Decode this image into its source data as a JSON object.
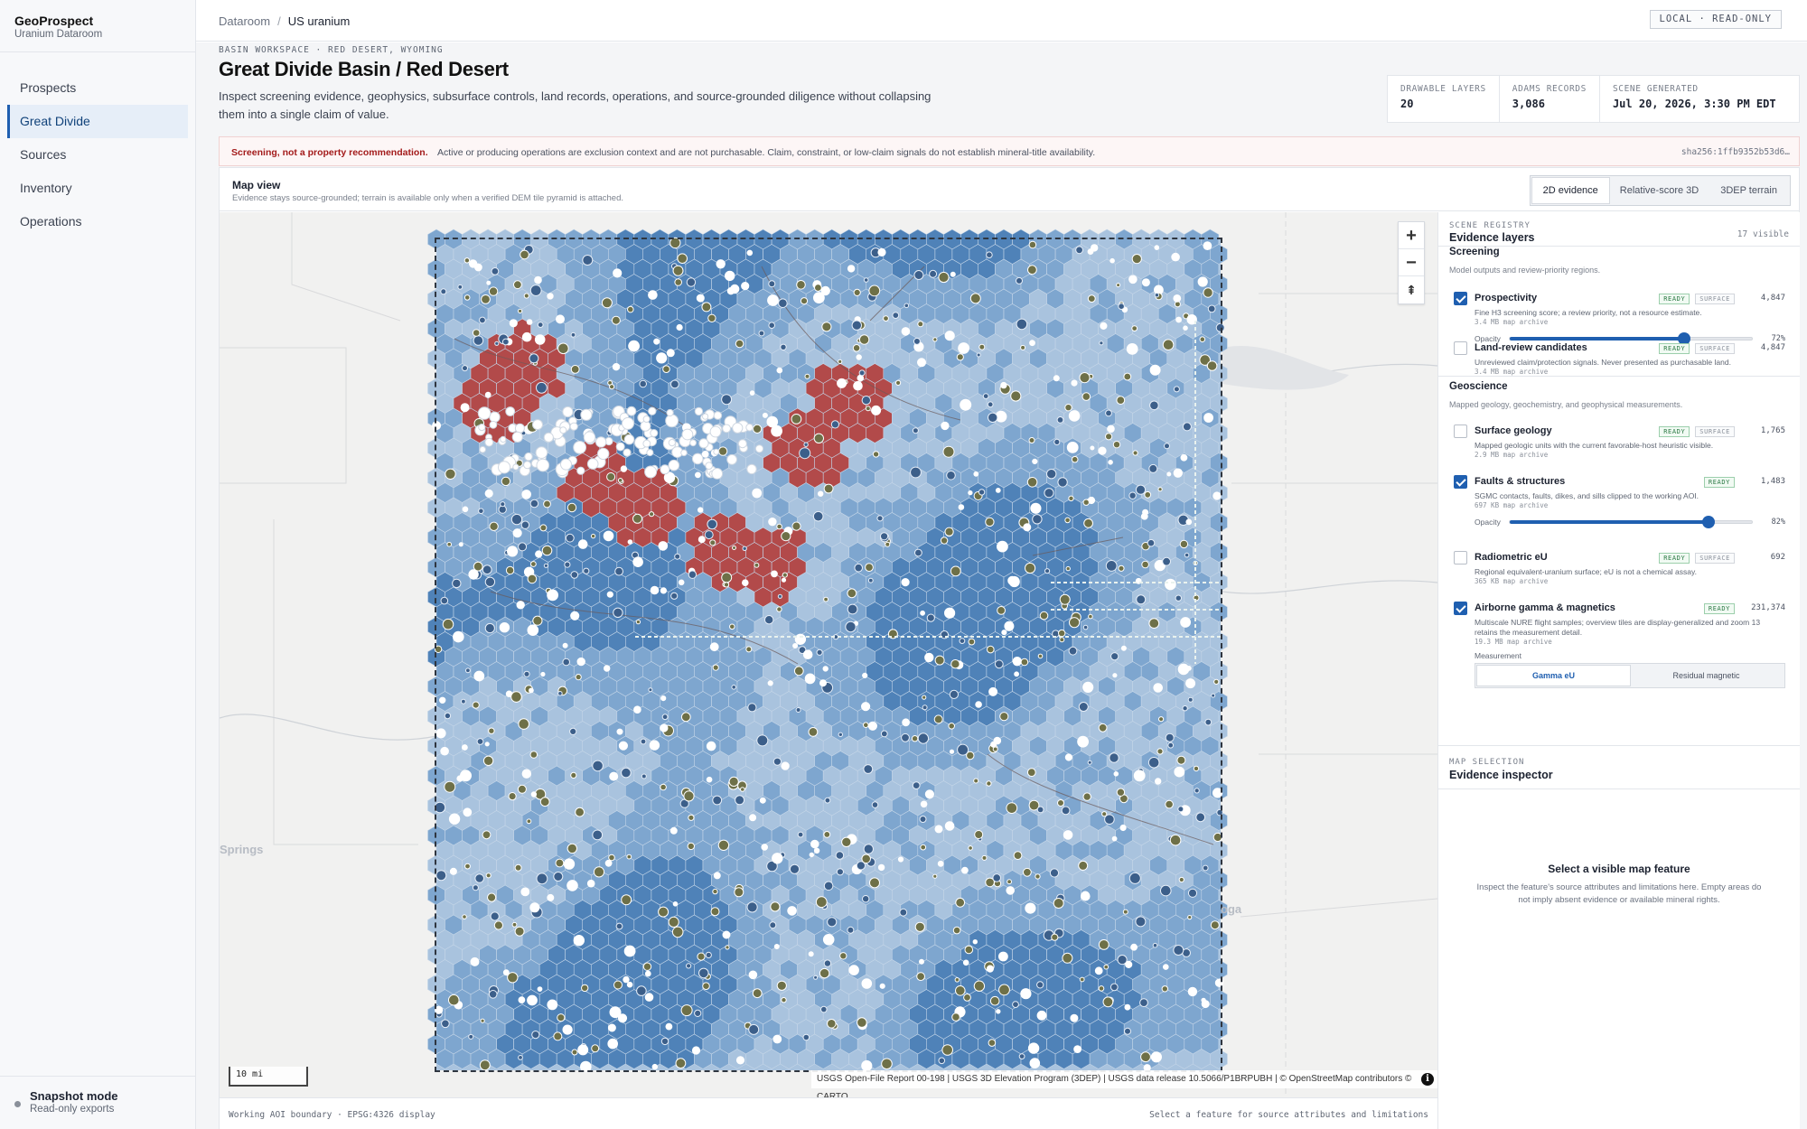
{
  "app": {
    "name": "GeoProspect",
    "subtitle": "Uranium Dataroom"
  },
  "nav": [
    {
      "label": "Prospects",
      "active": false
    },
    {
      "label": "Great Divide",
      "active": true
    },
    {
      "label": "Sources",
      "active": false
    },
    {
      "label": "Inventory",
      "active": false
    },
    {
      "label": "Operations",
      "active": false
    }
  ],
  "sidebar_footer": {
    "title": "Snapshot mode",
    "subtitle": "Read-only exports"
  },
  "breadcrumb": {
    "root": "Dataroom",
    "separator": "/",
    "current": "US uranium"
  },
  "mode_badge": "LOCAL · READ-ONLY",
  "header": {
    "eyebrow": "BASIN WORKSPACE · RED DESERT, WYOMING",
    "title": "Great Divide Basin / Red Desert",
    "description": "Inspect screening evidence, geophysics, subsurface controls, land records, operations, and source-grounded diligence without collapsing them into a single claim of value."
  },
  "stats": [
    {
      "label": "DRAWABLE LAYERS",
      "value": "20"
    },
    {
      "label": "ADAMS RECORDS",
      "value": "3,086"
    },
    {
      "label": "SCENE GENERATED",
      "value": "Jul 20, 2026, 3:30 PM EDT"
    }
  ],
  "warning": {
    "heading": "Screening, not a property recommendation.",
    "text": "Active or producing operations are exclusion context and are not purchasable. Claim, constraint, or low-claim signals do not establish mineral-title availability.",
    "hash": "sha256:1ffb9352b53d6…"
  },
  "map_view": {
    "title": "Map view",
    "subtitle": "Evidence stays source-grounded; terrain is available only when a verified DEM tile pyramid is attached.",
    "modes": [
      "2D evidence",
      "Relative-score 3D",
      "3DEP terrain"
    ],
    "active_mode": "2D evidence",
    "scale_label": "10 mi",
    "attribution": "USGS Open-File Report 00-198 | USGS 3D Elevation Program (3DEP) | USGS data release 10.5066/P1BRPUBH | © OpenStreetMap contributors © CARTO",
    "place_labels": [
      "Springs",
      "oga"
    ],
    "footer_left": "Working AOI boundary · EPSG:4326 display",
    "footer_right": "Select a feature for source attributes and limitations",
    "zoom_in": "+",
    "zoom_out": "−",
    "compass": "⇞",
    "info": "i"
  },
  "registry": {
    "eyebrow": "SCENE REGISTRY",
    "title": "Evidence layers",
    "count": "17 visible",
    "groups": [
      {
        "name": "Screening",
        "description": "Model outputs and review-priority regions."
      },
      {
        "name": "Geoscience",
        "description": "Mapped geology, geochemistry, and geophysical measurements."
      }
    ],
    "layers": [
      {
        "name": "Prospectivity",
        "checked": true,
        "badges": [
          "READY",
          "SURFACE"
        ],
        "count": "4,847",
        "description": "Fine H3 screening score; a review priority, not a resource estimate.",
        "size": "3.4 MB map archive",
        "opacity": 0.72,
        "opacity_label": "72%"
      },
      {
        "name": "Land-review candidates",
        "checked": false,
        "badges": [
          "READY",
          "SURFACE"
        ],
        "count": "4,847",
        "description": "Unreviewed claim/protection signals. Never presented as purchasable land.",
        "size": "3.4 MB map archive"
      },
      {
        "name": "Surface geology",
        "checked": false,
        "badges": [
          "READY",
          "SURFACE"
        ],
        "count": "1,765",
        "description": "Mapped geologic units with the current favorable-host heuristic visible.",
        "size": "2.9 MB map archive"
      },
      {
        "name": "Faults & structures",
        "checked": true,
        "badges": [
          "READY"
        ],
        "count": "1,483",
        "description": "SGMC contacts, faults, dikes, and sills clipped to the working AOI.",
        "size": "697 KB map archive",
        "opacity": 0.82,
        "opacity_label": "82%"
      },
      {
        "name": "Radiometric eU",
        "checked": false,
        "badges": [
          "READY",
          "SURFACE"
        ],
        "count": "692",
        "description": "Regional equivalent-uranium surface; eU is not a chemical assay.",
        "size": "365 KB map archive"
      },
      {
        "name": "Airborne gamma & magnetics",
        "checked": true,
        "badges": [
          "READY"
        ],
        "count": "231,374",
        "description": "Multiscale NURE flight samples; overview tiles are display-generalized and zoom 13 retains the measurement detail.",
        "size": "19.3 MB map archive"
      }
    ],
    "opacity_label": "Opacity",
    "measurement": {
      "label": "Measurement",
      "options": [
        "Gamma eU",
        "Residual magnetic"
      ],
      "active": "Gamma eU"
    }
  },
  "inspector": {
    "eyebrow": "MAP SELECTION",
    "title": "Evidence inspector",
    "empty_title": "Select a visible map feature",
    "empty_text": "Inspect the feature's source attributes and limitations here. Empty areas do not imply absent evidence or available mineral rights."
  },
  "colors": {
    "accent": "#1f5fb0",
    "warning": "#a31b1b",
    "hex_light": "#a9c3de",
    "hex_mid": "#7ea6cf",
    "hex_dark": "#4f82b8",
    "hot": "#b24a4a",
    "marker_olive": "#6e7048"
  }
}
